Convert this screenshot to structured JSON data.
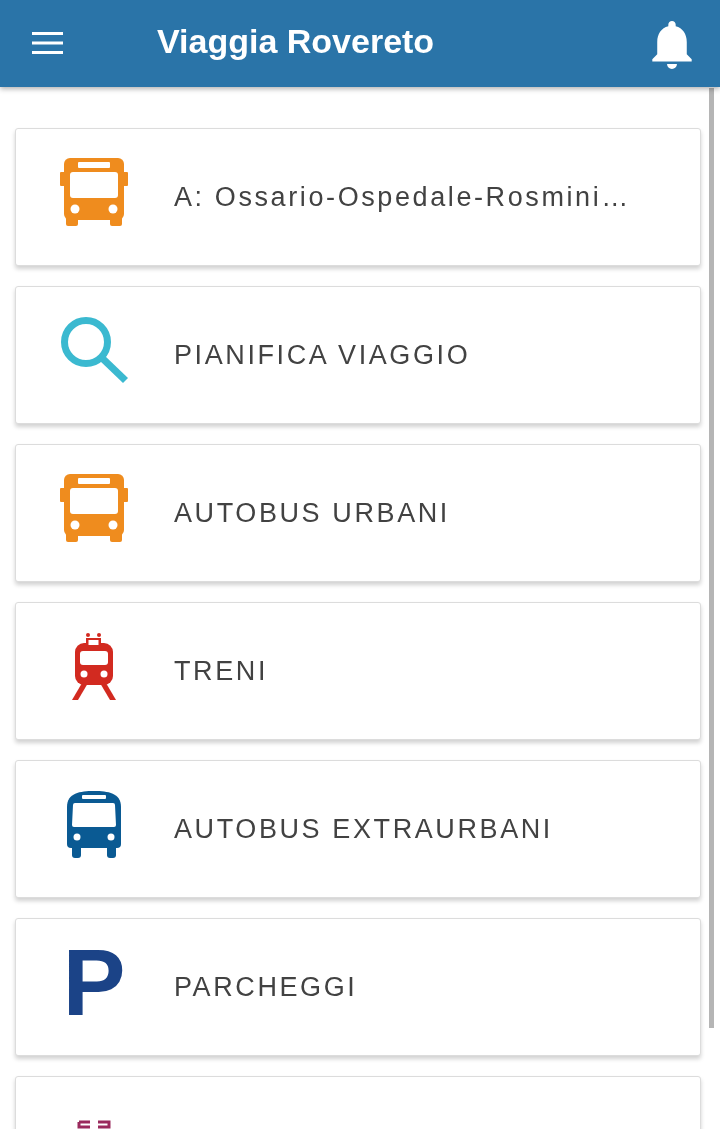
{
  "app_bar": {
    "title": "Viaggia Rovereto"
  },
  "menu_items": [
    {
      "kind": "bus",
      "label": "A: Ossario-Ospedale-Rosmini…"
    },
    {
      "kind": "search",
      "label": "PIANIFICA VIAGGIO"
    },
    {
      "kind": "bus",
      "label": "AUTOBUS URBANI"
    },
    {
      "kind": "train",
      "label": "TRENI"
    },
    {
      "kind": "coach",
      "label": "AUTOBUS EXTRAURBANI"
    },
    {
      "kind": "parking",
      "icon_text": "P",
      "label": "PARCHEGGI"
    },
    {
      "kind": "partial"
    }
  ]
}
